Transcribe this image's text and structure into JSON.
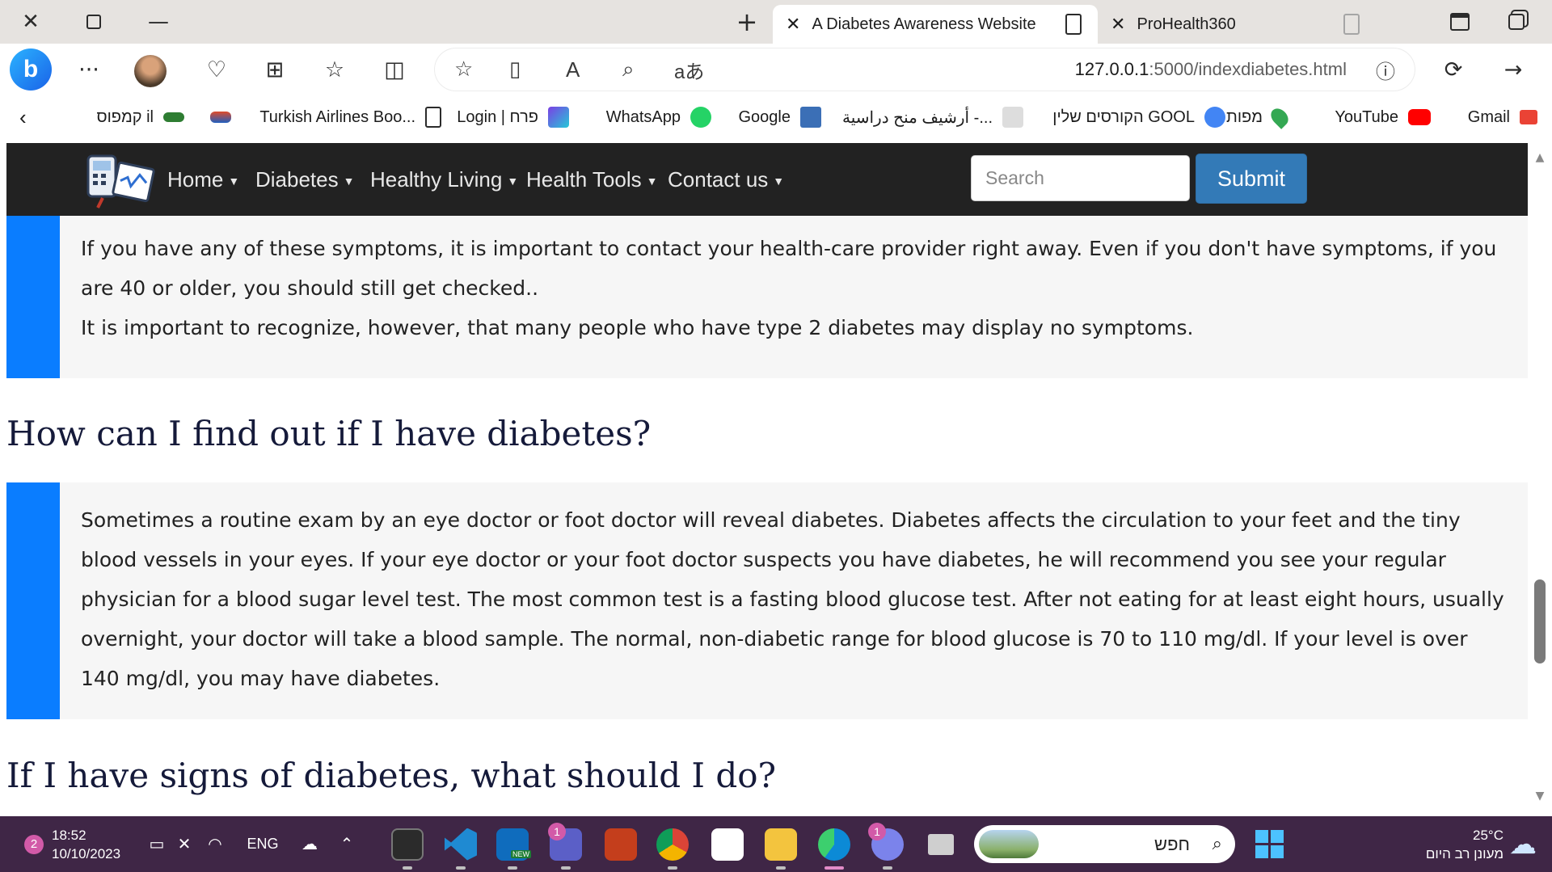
{
  "browser": {
    "tabs": [
      {
        "title": "A Diabetes Awareness Website",
        "active": true
      },
      {
        "title": "ProHealth360",
        "active": false
      }
    ],
    "url_host": "127.0.0.1",
    "url_rest": ":5000/indexdiabetes.html",
    "read_aloud_label": "A",
    "translate_label": "aあ",
    "favorites": [
      {
        "label": "Gmail",
        "icon": "gmail-icon",
        "color": "#ea4335"
      },
      {
        "label": "YouTube",
        "icon": "youtube-icon",
        "color": "#ff0000"
      },
      {
        "label": "מפות",
        "icon": "maps-icon",
        "color": "#34a853"
      },
      {
        "label": "הקורסים שלין GOOL",
        "icon": "gool-icon",
        "color": "#4285f4"
      },
      {
        "label": "أرشيف منح دراسية -...",
        "icon": "graduation-cap-icon",
        "color": "#444444"
      },
      {
        "label": "Google",
        "icon": "google-site-icon",
        "color": "#3b6fb6"
      },
      {
        "label": "WhatsApp",
        "icon": "whatsapp-icon",
        "color": "#25d366"
      },
      {
        "label": "Login | פרח",
        "icon": "perach-icon",
        "color": "#7b3fe4"
      },
      {
        "label": "Turkish Airlines Boo...",
        "icon": "document-icon",
        "color": "#ffffff"
      },
      {
        "label": "",
        "icon": "bookmark-logo-icon",
        "color": "#e04b2a"
      },
      {
        "label": "קמפוס il",
        "icon": "campus-icon",
        "color": "#2e7d32"
      }
    ]
  },
  "site": {
    "nav": [
      {
        "label": "Home"
      },
      {
        "label": "Diabetes"
      },
      {
        "label": "Healthy Living"
      },
      {
        "label": "Health Tools"
      },
      {
        "label": "Contact us"
      }
    ],
    "search_placeholder": "Search",
    "submit_label": "Submit"
  },
  "content": {
    "block1_line1": "If you have any of these symptoms, it is important to contact your health-care provider right away. Even if you don't have symptoms, if you are 40 or older, you should still get checked..",
    "block1_line2": "It is important to recognize, however, that many people who have type 2 diabetes may display no symptoms.",
    "heading1": "How can I find out if I have diabetes?",
    "block2": "Sometimes a routine exam by an eye doctor or foot doctor will reveal diabetes. Diabetes affects the circulation to your feet and the tiny blood vessels in your eyes. If your eye doctor or your foot doctor suspects you have diabetes, he will recommend you see your regular physician for a blood sugar level test. The most common test is a fasting blood glucose test. After not eating for at least eight hours, usually overnight, your doctor will take a blood sample. The normal, non-diabetic range for blood glucose is 70 to 110 mg/dl. If your level is over 140 mg/dl, you may have diabetes.",
    "heading2": "If I have signs of diabetes, what should I do?"
  },
  "taskbar": {
    "notification_count": "2",
    "time": "18:52",
    "date": "10/10/2023",
    "language": "ENG",
    "teams_badge": "1",
    "chat_badge": "1",
    "search_label": "חפש",
    "temperature": "25°C",
    "weather": "מעונן רב היום",
    "outlook_new_label": "NEW",
    "apps": [
      "terminal-icon",
      "vscode-icon",
      "outlook-icon",
      "teams-icon",
      "powerpoint-icon",
      "chrome-icon",
      "microsoft-store-icon",
      "file-explorer-icon",
      "edge-icon",
      "chat-icon",
      "task-view-icon"
    ]
  }
}
